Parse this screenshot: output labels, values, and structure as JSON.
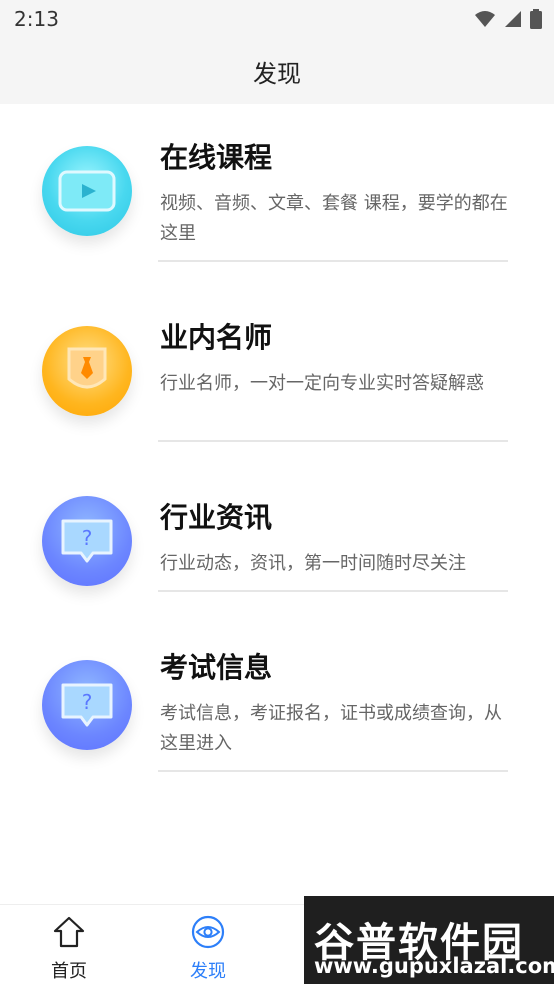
{
  "status_bar": {
    "time": "2:13"
  },
  "header": {
    "title": "发现"
  },
  "list": [
    {
      "title": "在线课程",
      "description": "视频、音频、文章、套餐 课程，要学的都在这里",
      "icon": "video-icon",
      "icon_colors": [
        "#3fd0ea",
        "#8ef2ff"
      ]
    },
    {
      "title": "业内名师",
      "description": "行业名师，一对一定向专业实时答疑解惑",
      "icon": "teacher-badge-icon",
      "icon_colors": [
        "#ffb21b",
        "#ffe18a"
      ]
    },
    {
      "title": "行业资讯",
      "description": "行业动态，资讯，第一时间随时尽关注",
      "icon": "question-bubble-icon",
      "icon_colors": [
        "#6b7cff",
        "#8bb6ff"
      ]
    },
    {
      "title": "考试信息",
      "description": "考试信息，考证报名，证书或成绩查询，从这里进入",
      "icon": "question-bubble-icon",
      "icon_colors": [
        "#6b7cff",
        "#8bb6ff"
      ]
    }
  ],
  "tabbar": {
    "tabs": [
      {
        "label": "首页",
        "icon": "home-icon",
        "active": false
      },
      {
        "label": "发现",
        "icon": "eye-icon",
        "active": true
      }
    ],
    "active_color": "#2d7ff9",
    "inactive_color": "#222222"
  },
  "watermark": {
    "title": "谷普软件园",
    "url": "www.gupuxlazal.com"
  }
}
